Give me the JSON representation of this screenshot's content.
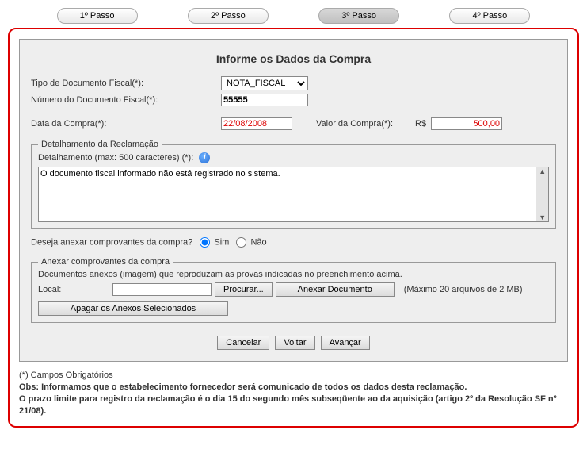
{
  "tabs": {
    "t1": "1º Passo",
    "t2": "2º Passo",
    "t3": "3º Passo",
    "t4": "4º Passo"
  },
  "title": "Informe os Dados da Compra",
  "labels": {
    "tipoDoc": "Tipo de Documento Fiscal(*):",
    "numDoc": "Número do Documento Fiscal(*):",
    "dataCompra": "Data da Compra(*):",
    "valorCompra": "Valor da Compra(*):",
    "rs": "R$",
    "detalhLegend": "Detalhamento da Reclamação",
    "detalhLabel": "Detalhamento (max: 500 caracteres) (*):",
    "anexarPergunta": "Deseja anexar comprovantes da compra?",
    "sim": "Sim",
    "nao": "Não",
    "anexarLegend": "Anexar comprovantes da compra",
    "anexarDesc": "Documentos anexos (imagem) que reproduzam as provas indicadas no preenchimento acima.",
    "local": "Local:",
    "procurar": "Procurar...",
    "anexarDoc": "Anexar Documento",
    "maxHint": "(Máximo 20 arquivos de 2 MB)",
    "apagar": "Apagar os Anexos Selecionados",
    "cancelar": "Cancelar",
    "voltar": "Voltar",
    "avancar": "Avançar"
  },
  "values": {
    "tipoDoc": "NOTA_FISCAL",
    "numDoc": "55555",
    "dataCompra": "22/08/2008",
    "valorCompra": "500,00",
    "detalh": "O documento fiscal informado não está registrado no sistema.",
    "filePath": ""
  },
  "footer": {
    "l1": "(*) Campos Obrigatórios",
    "l2": "Obs: Informamos que o estabelecimento fornecedor será comunicado de todos os dados desta reclamação.",
    "l3": "O prazo limite para registro da reclamação é o dia 15 do segundo mês subseqüente ao da aquisição (artigo 2º da Resolução SF nº 21/08)."
  }
}
